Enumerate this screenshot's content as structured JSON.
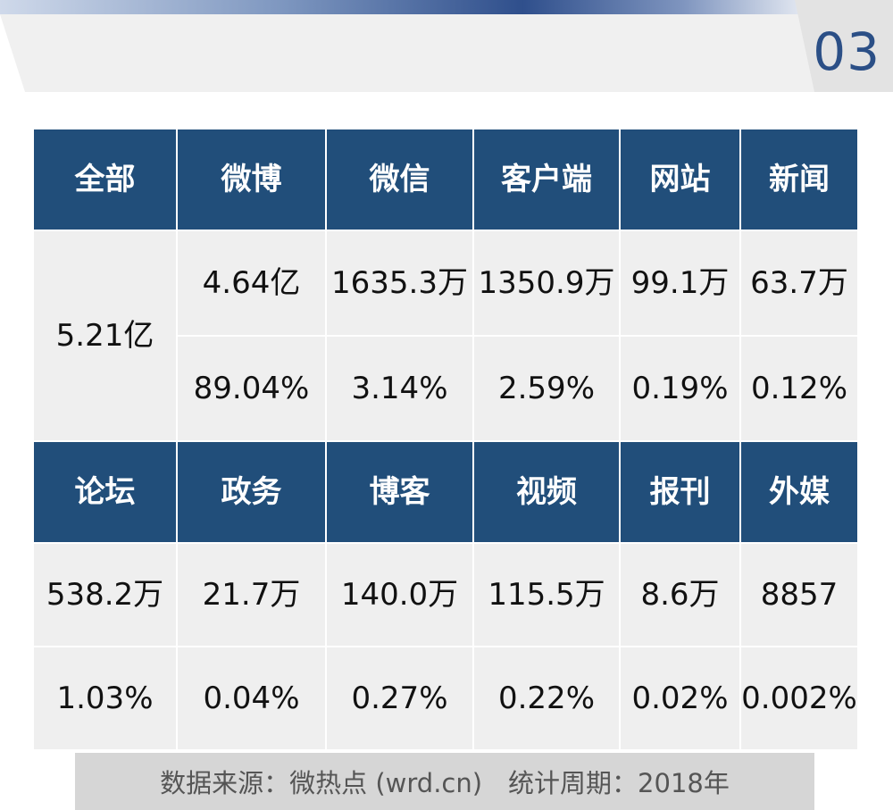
{
  "header": {
    "page_number": "03"
  },
  "table": {
    "row1_headers": [
      "全部",
      "微博",
      "微信",
      "客户端",
      "网站",
      "新闻"
    ],
    "total": "5.21亿",
    "row1_counts": [
      "4.64亿",
      "1635.3万",
      "1350.9万",
      "99.1万",
      "63.7万"
    ],
    "row1_shares": [
      "89.04%",
      "3.14%",
      "2.59%",
      "0.19%",
      "0.12%"
    ],
    "row2_headers": [
      "论坛",
      "政务",
      "博客",
      "视频",
      "报刊",
      "外媒"
    ],
    "row2_counts": [
      "538.2万",
      "21.7万",
      "140.0万",
      "115.5万",
      "8.6万",
      "8857"
    ],
    "row2_shares": [
      "1.03%",
      "0.04%",
      "0.27%",
      "0.22%",
      "0.02%",
      "0.002%"
    ]
  },
  "footer": {
    "source_text": "数据来源：微热点 (wrd.cn)　统计周期：2018年"
  }
}
